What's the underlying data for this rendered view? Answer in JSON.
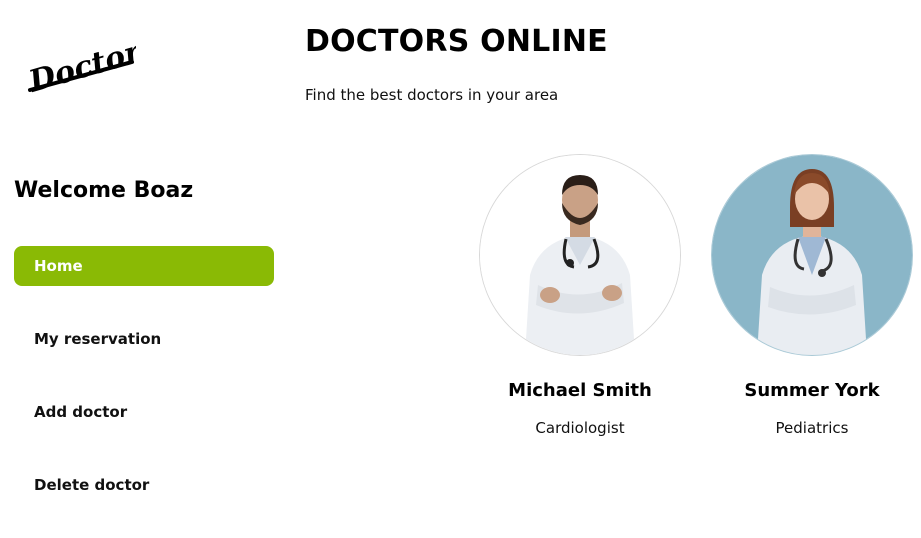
{
  "logo": {
    "text": "Doctors"
  },
  "header": {
    "title": "DOCTORS ONLINE",
    "subtitle": "Find the best doctors in your area"
  },
  "sidebar": {
    "welcome": "Welcome Boaz",
    "items": [
      {
        "label": "Home",
        "active": true
      },
      {
        "label": "My reservation"
      },
      {
        "label": "Add doctor"
      },
      {
        "label": "Delete doctor"
      }
    ]
  },
  "doctors": [
    {
      "name": "Michael Smith",
      "specialty": "Cardiologist",
      "photo": "doctor-male-photo"
    },
    {
      "name": "Summer York",
      "specialty": "Pediatrics",
      "photo": "doctor-female-photo"
    }
  ],
  "colors": {
    "accent": "#8aba05",
    "female_photo_bg": "#8ab6c8"
  }
}
